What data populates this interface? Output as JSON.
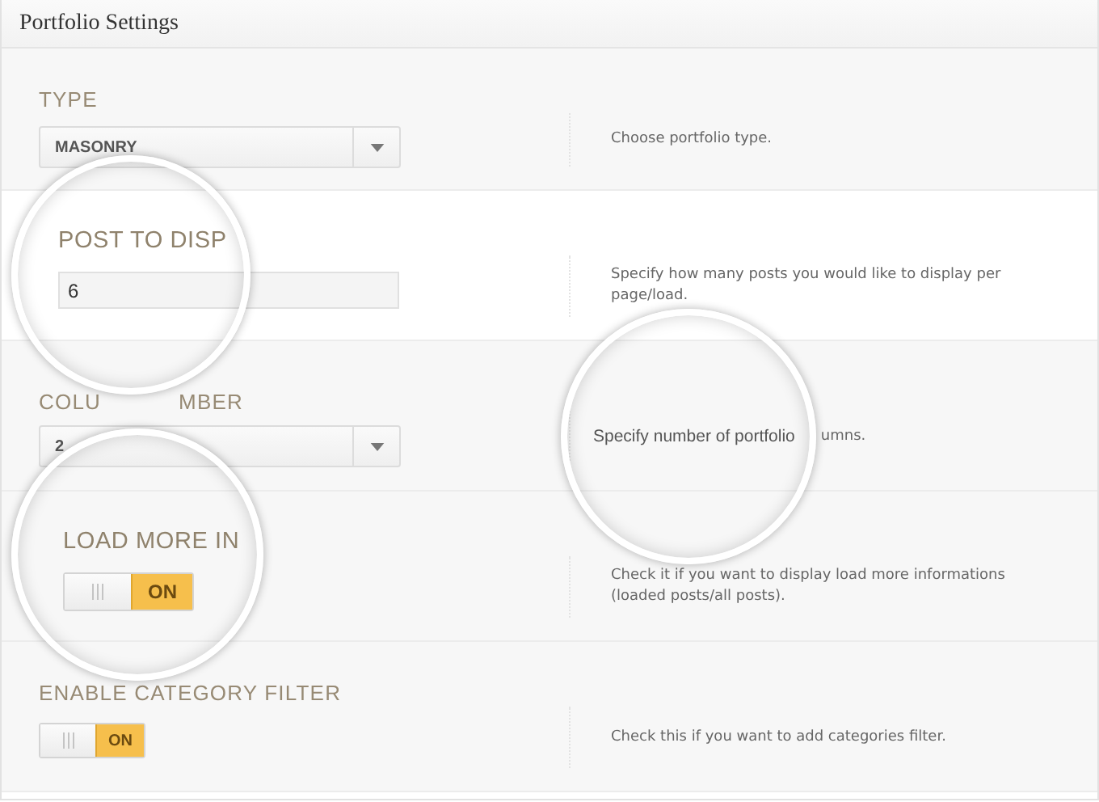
{
  "panel": {
    "title": "Portfolio Settings"
  },
  "rows": [
    {
      "kind": "select",
      "label": [
        "TYPE"
      ],
      "value": "MASONRY",
      "description": [
        "Choose portfolio type."
      ]
    },
    {
      "kind": "text",
      "label": [
        "POST TO DISP"
      ],
      "value": "6",
      "description": [
        "Specify how many posts you would like to display per page/load."
      ]
    },
    {
      "kind": "select",
      "label": [
        "COLU",
        "MBER"
      ],
      "value": "2",
      "description": [
        "Specify number of portfolio",
        "umns."
      ]
    },
    {
      "kind": "toggle",
      "label": [
        "LOAD MORE IN"
      ],
      "on": true,
      "state_text": "ON",
      "description": [
        "Check it if you want to display load more informations (loaded posts/all posts)."
      ]
    },
    {
      "kind": "toggle",
      "label": [
        "ENABLE CATEGORY FILTER"
      ],
      "on": true,
      "state_text": "ON",
      "description": [
        "Check this if you want to add categories filter."
      ]
    }
  ]
}
